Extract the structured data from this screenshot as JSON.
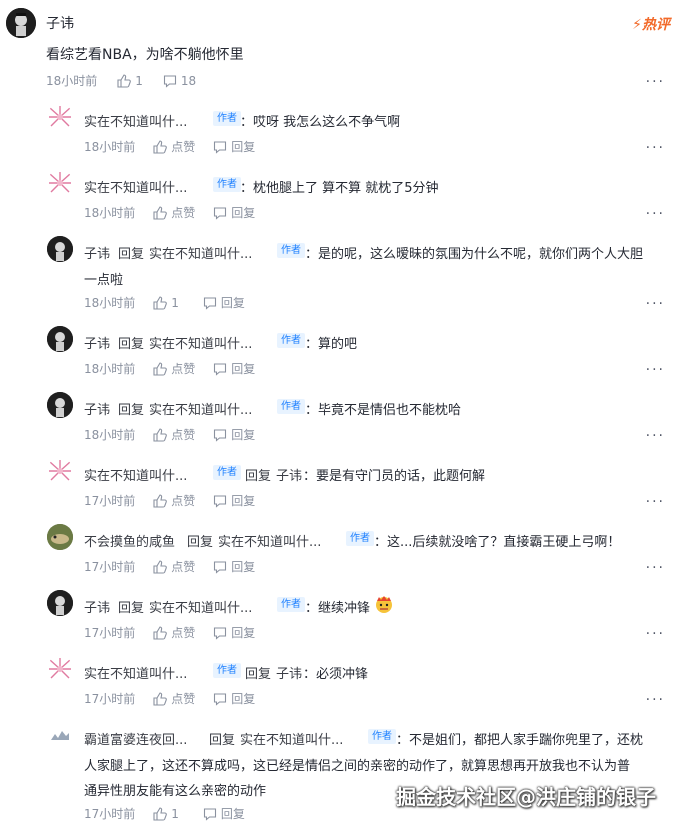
{
  "main": {
    "user": "子讳",
    "text": "看综艺看NBA，为啥不躺他怀里",
    "time": "18小时前",
    "likes": "1",
    "comments": "18",
    "badge": "热评"
  },
  "labels": {
    "author": "作者",
    "reply": "回复",
    "like": "点赞",
    "reply_btn": "回复",
    "more": "···"
  },
  "replies": [
    {
      "user": "实在不知道叫什...",
      "target": "",
      "text": "：哎呀 我怎么这么不争气啊",
      "time": "18小时前",
      "likes": "点赞"
    },
    {
      "user": "实在不知道叫什...",
      "target": "",
      "text": "：枕他腿上了 算不算 就枕了5分钟",
      "time": "18小时前",
      "likes": "点赞"
    },
    {
      "user": "子讳",
      "target": "实在不知道叫什...",
      "text": "：是的呢，这么暧昧的氛围为什么不呢，就你们两个人大胆",
      "text2": "一点啦",
      "time": "18小时前",
      "likes": "1"
    },
    {
      "user": "子讳",
      "target": "实在不知道叫什...",
      "text": "：算的吧",
      "time": "18小时前",
      "likes": "点赞"
    },
    {
      "user": "子讳",
      "target": "实在不知道叫什...",
      "text": "：毕竟不是情侣也不能枕哈",
      "time": "18小时前",
      "likes": "点赞"
    },
    {
      "user": "实在不知道叫什...",
      "target": "子讳",
      "text": "：要是有守门员的话，此题何解",
      "time": "17小时前",
      "likes": "点赞"
    },
    {
      "user": "不会摸鱼的咸鱼",
      "target": "实在不知道叫什...",
      "text": "：这...后续就没啥了？直接霸王硬上弓啊！",
      "time": "17小时前",
      "likes": "点赞"
    },
    {
      "user": "子讳",
      "target": "实在不知道叫什...",
      "text": "：继续冲锋",
      "time": "17小时前",
      "likes": "点赞"
    },
    {
      "user": "实在不知道叫什...",
      "target": "子讳",
      "text": "：必须冲锋",
      "time": "17小时前",
      "likes": "点赞"
    },
    {
      "user": "霸道富婆连夜回...",
      "target": "实在不知道叫什...",
      "text": "：不是姐们，都把人家手踹你兜里了，还枕",
      "text2": "人家腿上了，这还不算成吗，这已经是情侣之间的亲密的动作了，就算思想再开放我也不认为普",
      "text3": "通异性朋友能有这么亲密的动作",
      "time": "17小时前",
      "likes": "1"
    }
  ],
  "watermark": "掘金技术社区@洪庄铺的银子"
}
